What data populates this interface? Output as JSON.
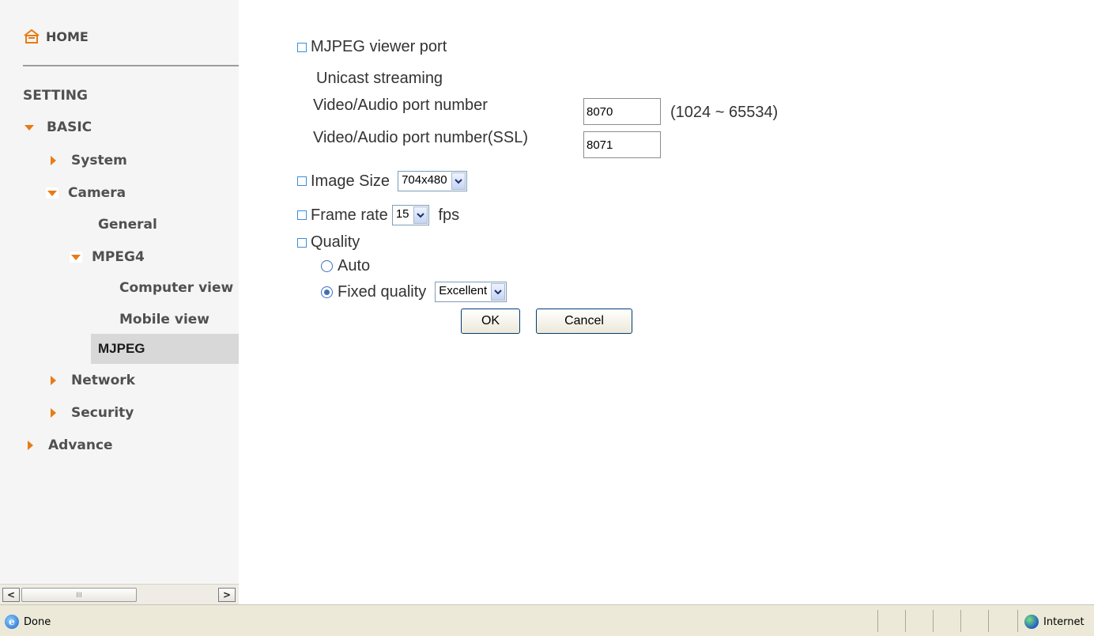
{
  "sidebar": {
    "home": "HOME",
    "setting_heading": "SETTING",
    "items": {
      "basic": "BASIC",
      "system": "System",
      "camera": "Camera",
      "general": "General",
      "mpeg4": "MPEG4",
      "computer_view": "Computer view",
      "mobile_view": "Mobile view",
      "mjpeg": "MJPEG",
      "network": "Network",
      "security": "Security",
      "advance": "Advance"
    },
    "selected_item": "MJPEG",
    "accent_color": "#e87b14"
  },
  "scrollbar": {
    "left_arrow": "<",
    "right_arrow": ">",
    "thumb_grip": "III"
  },
  "form": {
    "viewer_port_heading": "MJPEG viewer port",
    "unicast_label": "Unicast streaming",
    "port_label": "Video/Audio port number",
    "port_value": "8070",
    "port_range": "(1024 ~ 65534)",
    "ssl_port_label": "Video/Audio port number(SSL)",
    "ssl_port_value": "8071",
    "image_size_label": "Image Size",
    "image_size_value": "704x480",
    "frame_rate_label": "Frame rate",
    "frame_rate_value": "15",
    "frame_rate_unit": "fps",
    "quality_label": "Quality",
    "quality_auto": "Auto",
    "quality_fixed": "Fixed quality",
    "quality_selected": "Fixed quality",
    "quality_value": "Excellent",
    "ok_button": "OK",
    "cancel_button": "Cancel",
    "bullet_color": "#3a8fd9"
  },
  "statusbar": {
    "status_text": "Done",
    "zone_text": "Internet"
  }
}
